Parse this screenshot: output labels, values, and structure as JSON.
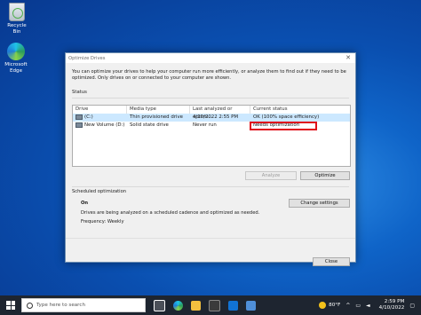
{
  "desktop": {
    "icons": [
      {
        "label": "Recycle Bin",
        "icon": "recycle-bin-icon"
      },
      {
        "label": "Microsoft Edge",
        "icon": "edge-icon"
      }
    ]
  },
  "window": {
    "title": "Optimize Drives",
    "intro_line1": "You can optimize your drives to help your computer run more efficiently, or analyze them to find out if they need to be",
    "intro_line2": "optimized. Only drives on or connected to your computer are shown.",
    "status_label": "Status",
    "columns": [
      "Drive",
      "Media type",
      "Last analyzed or optimi...",
      "Current status"
    ],
    "rows": [
      {
        "drive": "(C:)",
        "media": "Thin provisioned drive",
        "last": "4/10/2022 2:55 PM",
        "status": "OK (100% space efficiency)"
      },
      {
        "drive": "New Volume (D:)",
        "media": "Solid state drive",
        "last": "Never run",
        "status": "Needs optimization"
      }
    ],
    "analyze_button": "Analyze",
    "optimize_button": "Optimize",
    "scheduled_label": "Scheduled optimization",
    "scheduled_state": "On",
    "scheduled_desc": "Drives are being analyzed on a scheduled cadence and optimized as needed.",
    "frequency": "Frequency: Weekly",
    "change_button": "Change settings",
    "close_button": "Close",
    "highlight_color": "#e0101a"
  },
  "taskbar": {
    "search_placeholder": "Type here to search",
    "temperature": "80°F",
    "time": "2:59 PM",
    "date": "4/10/2022"
  }
}
